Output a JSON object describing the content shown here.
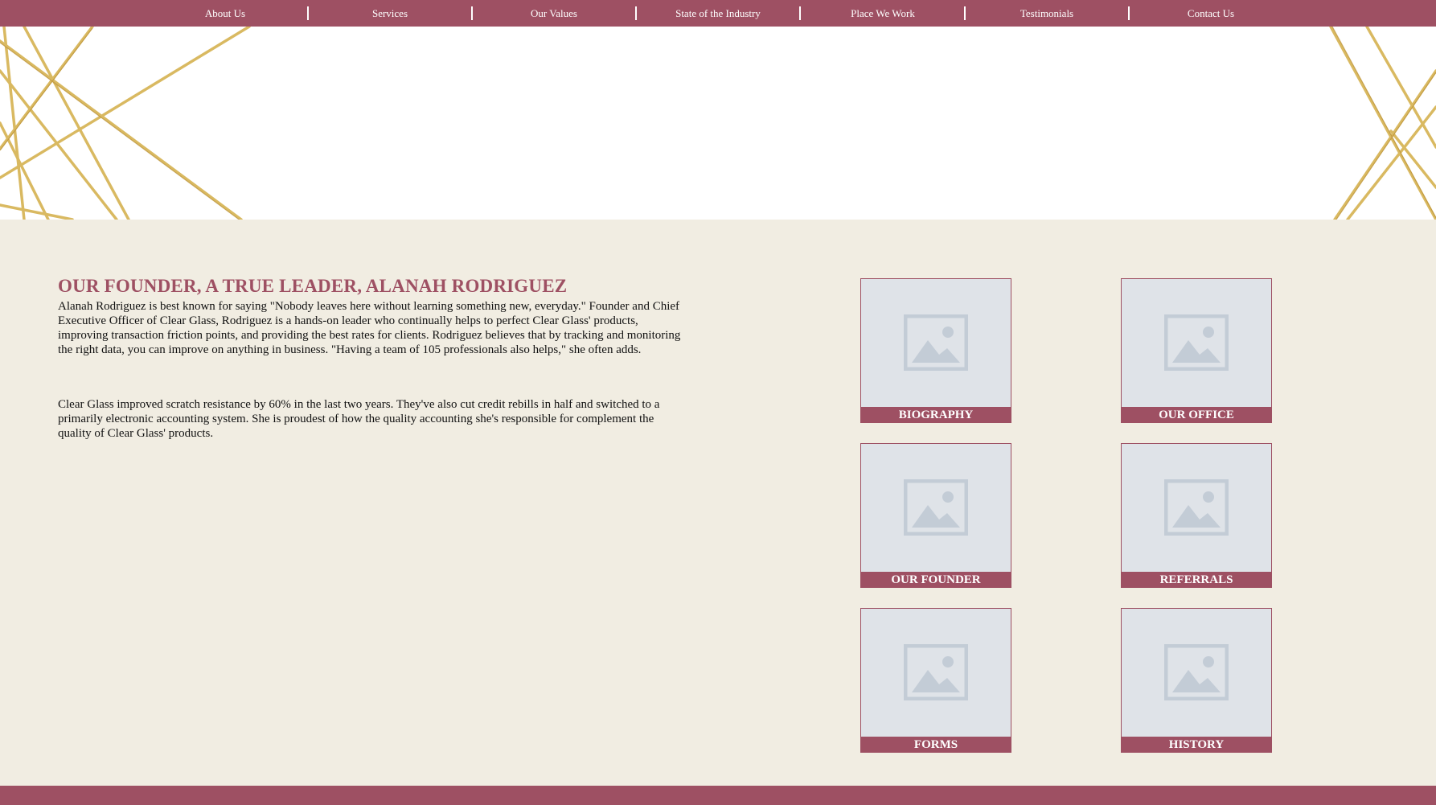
{
  "nav": {
    "items": [
      {
        "label": "About Us"
      },
      {
        "label": "Services"
      },
      {
        "label": "Our Values"
      },
      {
        "label": "State of the Industry"
      },
      {
        "label": "Place We Work"
      },
      {
        "label": "Testimonials"
      },
      {
        "label": "Contact Us"
      }
    ]
  },
  "main": {
    "headline": "OUR FOUNDER, A TRUE LEADER, ALANAH RODRIGUEZ",
    "paragraphs": [
      "Alanah Rodriguez is best known for saying \"Nobody leaves here without learning something new, everyday.\" Founder and Chief Executive Officer of Clear Glass, Rodriguez is a hands-on leader who continually helps to perfect Clear Glass' products, improving transaction friction points, and providing the best rates for clients. Rodriguez believes that by tracking and monitoring the right data, you can improve on anything in business. \"Having a team of 105 professionals also helps,\" she often adds.",
      "Clear Glass improved scratch resistance by 60% in the last two years. They've also cut credit rebills in half and switched to a primarily electronic accounting system. She is proudest of how the quality accounting she's responsible for complement the quality of Clear Glass' products."
    ]
  },
  "tiles": [
    {
      "label": "BIOGRAPHY",
      "icon": "image-placeholder-icon"
    },
    {
      "label": "OUR OFFICE",
      "icon": "image-placeholder-icon"
    },
    {
      "label": "OUR FOUNDER",
      "icon": "image-placeholder-icon"
    },
    {
      "label": "REFERRALS",
      "icon": "image-placeholder-icon"
    },
    {
      "label": "FORMS",
      "icon": "image-placeholder-icon"
    },
    {
      "label": "HISTORY",
      "icon": "image-placeholder-icon"
    }
  ],
  "colors": {
    "brand": "#9e5063",
    "background": "#f1ede2",
    "hero_lines": "#d7b659",
    "placeholder": "#dfe3e8",
    "placeholder_icon": "#c3ccd6"
  }
}
